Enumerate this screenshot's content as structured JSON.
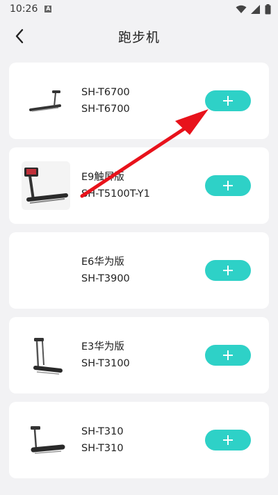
{
  "status_bar": {
    "time": "10:26",
    "a_badge": "A"
  },
  "header": {
    "title": "跑步机"
  },
  "products": [
    {
      "name": "SH-T6700",
      "model": "SH-T6700",
      "thumb": "treadmill-small"
    },
    {
      "name": "E9触屏版",
      "model": "SH-T5100T-Y1",
      "thumb": "treadmill-large"
    },
    {
      "name": "E6华为版",
      "model": "SH-T3900",
      "thumb": "none"
    },
    {
      "name": "E3华为版",
      "model": "SH-T3100",
      "thumb": "treadmill-compact"
    },
    {
      "name": "SH-T310",
      "model": "SH-T310",
      "thumb": "treadmill-folding"
    }
  ],
  "colors": {
    "accent": "#2ed1c7",
    "arrow": "#e8121b",
    "background": "#f2f2f4"
  }
}
